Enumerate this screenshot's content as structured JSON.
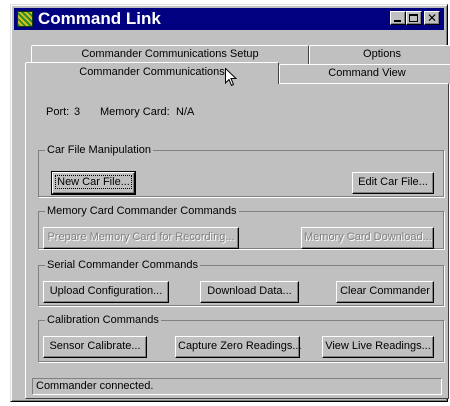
{
  "window": {
    "title": "Command Link"
  },
  "tabs": {
    "setup": "Commander Communications Setup",
    "options": "Options",
    "communications": "Commander Communications",
    "command_view": "Command View"
  },
  "info": {
    "port_label": "Port:",
    "port_value": "3",
    "memory_label": "Memory Card:",
    "memory_value": "N/A"
  },
  "car_file": {
    "legend": "Car File Manipulation",
    "new_button": "New Car File...",
    "edit_button": "Edit Car File..."
  },
  "memory_card": {
    "legend": "Memory Card Commander Commands",
    "prepare_button": "Prepare Memory Card for Recording...",
    "download_button": "Memory Card Download..."
  },
  "serial": {
    "legend": "Serial Commander Commands",
    "upload_button": "Upload Configuration...",
    "download_button": "Download Data...",
    "clear_button": "Clear Commander"
  },
  "calibration": {
    "legend": "Calibration Commands",
    "sensor_button": "Sensor Calibrate...",
    "capture_button": "Capture Zero Readings...",
    "view_button": "View Live Readings..."
  },
  "status_bar": {
    "text": "Commander connected."
  },
  "colors": {
    "face": "#c0c0c0",
    "title_bar": "#000080",
    "disabled_text": "#808080"
  }
}
